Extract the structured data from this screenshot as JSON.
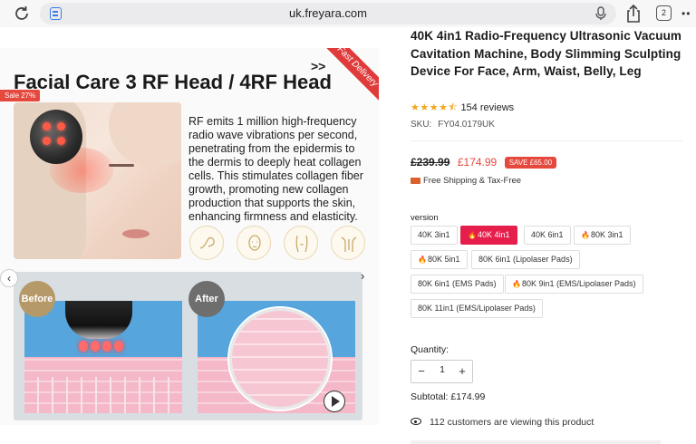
{
  "browser": {
    "url": "uk.freyara.com",
    "tab_count": "2"
  },
  "gallery": {
    "sale_badge": "Sale 27%",
    "promo_title": "Facial Care 3 RF Head / 4RF Head",
    "chevrons": ">>",
    "ribbon": "Fast Delivery",
    "description": "RF emits 1 million high-frequency radio wave vibrations per second, penetrating from the epidermis to the dermis to deeply heat collagen cells. This stimulates collagen fiber growth, promoting new collagen production that supports the skin, enhancing firmness and elasticity.",
    "before_label": "Before",
    "after_label": "After",
    "icons": [
      "arm-icon",
      "face-icon",
      "belly-icon",
      "back-icon"
    ]
  },
  "product": {
    "title": "40K 4in1 Radio-Frequency Ultrasonic Vacuum Cavitation Machine, Body Slimming Sculpting Device For Face, Arm, Waist, Belly, Leg",
    "rating": 4.5,
    "stars": "★★★★⯪",
    "reviews": "154 reviews",
    "sku_label": "SKU:",
    "sku": "FY04.0179UK",
    "price_old": "£239.99",
    "price_new": "£174.99",
    "save_tag": "SAVE £65.00",
    "shipping": "Free Shipping & Tax-Free",
    "version_label": "version",
    "options": [
      {
        "label": "40K 3in1",
        "flame": false,
        "selected": false
      },
      {
        "label": "40K 4in1",
        "flame": true,
        "selected": true
      },
      {
        "label": "40K 6in1",
        "flame": false,
        "selected": false
      },
      {
        "label": "80K 3in1",
        "flame": true,
        "selected": false
      },
      {
        "label": "80K 5in1",
        "flame": true,
        "selected": false
      },
      {
        "label": "80K 6in1 (Lipolaser Pads)",
        "flame": false,
        "selected": false
      },
      {
        "label": "80K 6in1 (EMS Pads)",
        "flame": false,
        "selected": false
      },
      {
        "label": "80K 9in1 (EMS/Lipolaser Pads)",
        "flame": true,
        "selected": false
      },
      {
        "label": "80K 11in1 (EMS/Lipolaser Pads)",
        "flame": false,
        "selected": false
      }
    ],
    "quantity_label": "Quantity:",
    "quantity": "1",
    "subtotal": "Subtotal: £174.99",
    "viewers": "112 customers are viewing this product",
    "accent": "#e51e4b",
    "price_color": "#e5483d"
  }
}
